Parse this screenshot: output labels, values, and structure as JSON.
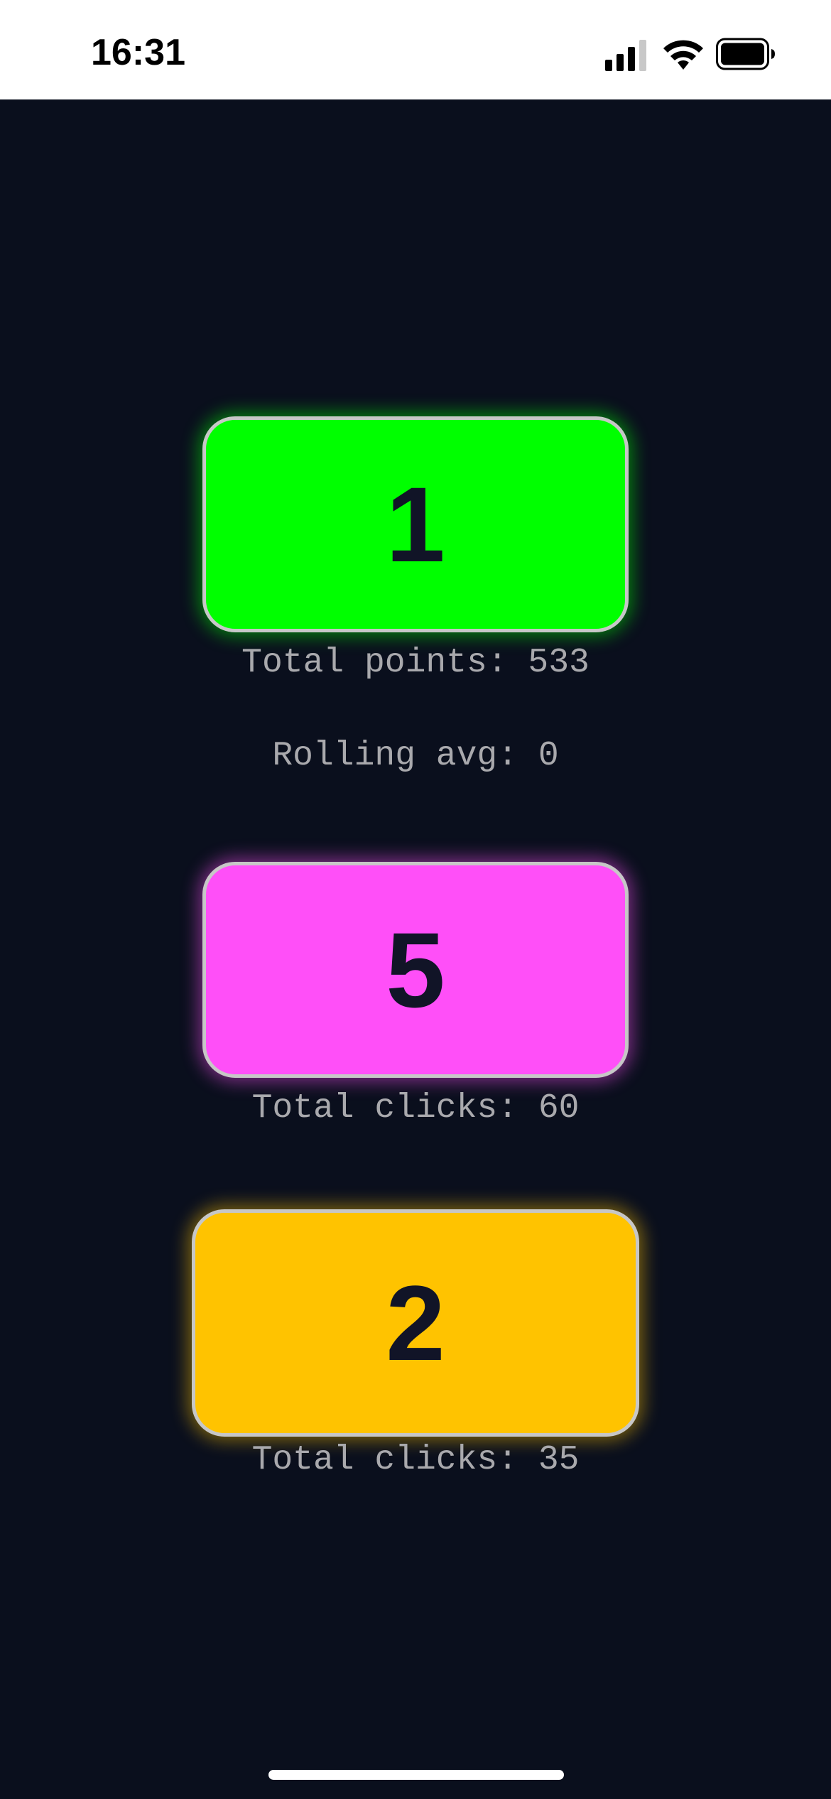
{
  "status_bar": {
    "time": "16:31",
    "icons": [
      "signal-icon",
      "wifi-icon",
      "battery-icon"
    ]
  },
  "counters": [
    {
      "value": "1",
      "color": "#00ff00",
      "stats": [
        "Total points: 533",
        "Rolling avg: 0"
      ]
    },
    {
      "value": "5",
      "color": "#ff4ff8",
      "stats": [
        "Total clicks: 60"
      ]
    },
    {
      "value": "2",
      "color": "#ffc300",
      "stats": [
        "Total clicks: 35"
      ]
    }
  ],
  "theme": {
    "background": "#0a0f1d",
    "button_text": "#111427",
    "stat_text": "#a9a9ad",
    "button_border": "#c7c7c7"
  }
}
